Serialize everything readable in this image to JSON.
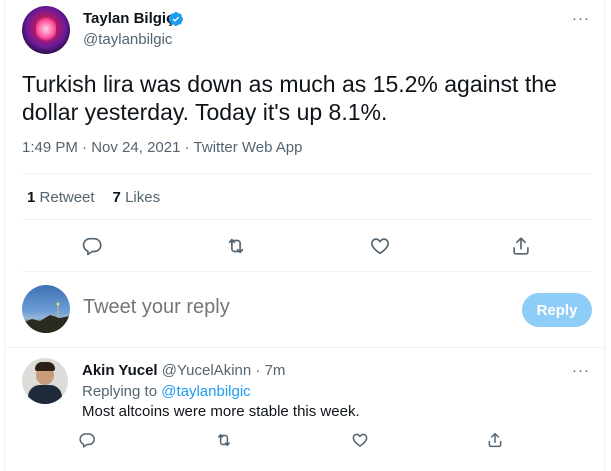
{
  "tweet": {
    "author_name": "Taylan Bilgiç",
    "handle": "@taylanbilgic",
    "text": "Turkish lira was down as much as 15.2% against the dollar yesterday. Today it's up 8.1%.",
    "time": "1:49 PM",
    "date": "Nov 24, 2021",
    "separator": "·",
    "source": "Twitter Web App",
    "retweets_count": "1",
    "retweets_label": "Retweet",
    "likes_count": "7",
    "likes_label": "Likes",
    "more": "···"
  },
  "composer": {
    "placeholder": "Tweet your reply",
    "button_label": "Reply"
  },
  "reply": {
    "author_name": "Akin Yucel",
    "handle": "@YucelAkinn",
    "separator": "·",
    "time": "7m",
    "replying_prefix": "Replying to",
    "replying_to": "@taylanbilgic",
    "text": "Most altcoins were more stable this week.",
    "more": "···"
  },
  "icons": {
    "reply": "reply-icon",
    "retweet": "retweet-icon",
    "like": "heart-icon",
    "share": "share-icon",
    "verified": "verified-badge-icon"
  },
  "colors": {
    "accent": "#1d9bf0",
    "reply_button_disabled": "#8ecdf7",
    "secondary_text": "#536471",
    "primary_text": "#0f1419"
  }
}
